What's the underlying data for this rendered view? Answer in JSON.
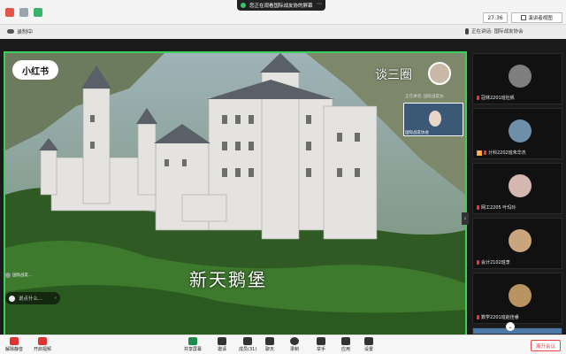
{
  "topbar": {
    "share_status": "您正在观看国际战友协的屏幕",
    "time": "27:36",
    "view_label": "演讲者视图"
  },
  "strip": {
    "recording": "录制中",
    "speaking": "正在讲话: 国际战友协会"
  },
  "video": {
    "logo": "小红书",
    "creator": "谈三圈",
    "caption": "新天鹅堡",
    "mini_label_top": "正在讲话: 国际战友协",
    "mini_label": "国际战友协会",
    "user_chip": "国际战友...",
    "comment": "说点什么..."
  },
  "gallery": [
    {
      "name": "冠林2201班杜帆",
      "avatar_color": "#7f7f7f"
    },
    {
      "name": "计科2202班朱华杰",
      "avatar_color": "#6d8faa",
      "badge": "主"
    },
    {
      "name": "网工2205 叶玛玲",
      "avatar_color": "#d4b7b0"
    },
    {
      "name": "会计2102班李",
      "avatar_color": "#c9a47d"
    },
    {
      "name": "数学2201班赵佳睿",
      "avatar_color": "#b89560"
    },
    {
      "name": "",
      "avatar_color": "#4c79a8"
    }
  ],
  "toolbar": {
    "items": [
      {
        "label": "解除静音",
        "icon": "mic-off-icon"
      },
      {
        "label": "开启视频",
        "icon": "camera-off-icon"
      },
      {
        "label": "共享屏幕",
        "icon": "screen-share-icon"
      },
      {
        "label": "邀请",
        "icon": "invite-icon"
      },
      {
        "label": "成员(31)",
        "icon": "members-icon"
      },
      {
        "label": "聊天",
        "icon": "chat-icon"
      },
      {
        "label": "录制",
        "icon": "record-icon"
      },
      {
        "label": "举手",
        "icon": "hand-icon"
      },
      {
        "label": "应用",
        "icon": "apps-icon"
      },
      {
        "label": "设置",
        "icon": "settings-icon"
      }
    ],
    "end_meeting": "离开会议"
  },
  "colors": {
    "share_border": "#3ad05c",
    "end_red": "#e44444"
  }
}
